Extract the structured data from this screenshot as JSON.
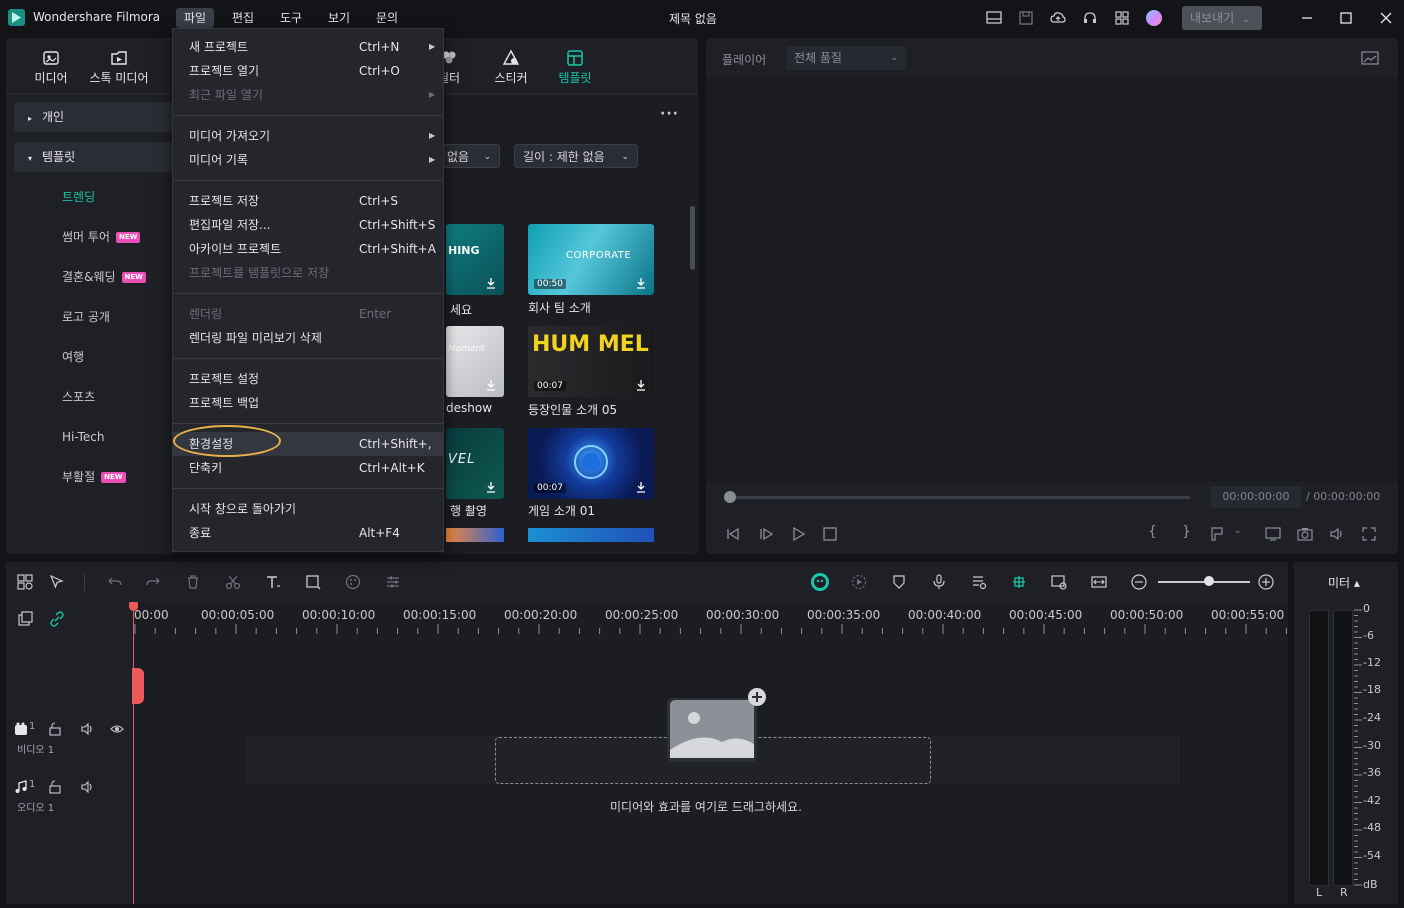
{
  "app": {
    "name": "Wondershare Filmora",
    "document_title": "제목 없음",
    "export_label": "내보내기"
  },
  "menubar": {
    "items": [
      "파일",
      "편집",
      "도구",
      "보기",
      "문의"
    ]
  },
  "library": {
    "tabs": [
      "미디어",
      "스톡 미디어",
      "필터",
      "스티커",
      "템플릿"
    ],
    "more_label": "···",
    "sidebar": {
      "groups": [
        {
          "label": "개인",
          "expanded": false
        },
        {
          "label": "템플릿",
          "expanded": true
        }
      ],
      "items": [
        {
          "label": "트렌딩",
          "new": false,
          "active": true
        },
        {
          "label": "썸머 투어",
          "new": true,
          "active": false
        },
        {
          "label": "결혼&웨딩",
          "new": true,
          "active": false
        },
        {
          "label": "로고 공개",
          "new": false,
          "active": false
        },
        {
          "label": "여행",
          "new": false,
          "active": false
        },
        {
          "label": "스포츠",
          "new": false,
          "active": false
        },
        {
          "label": "Hi-Tech",
          "new": false,
          "active": false
        },
        {
          "label": "부활절",
          "new": true,
          "active": false
        }
      ],
      "new_badge": "NEW"
    },
    "filters": [
      {
        "label": "없음"
      },
      {
        "label": "길이 : 제한 없음"
      }
    ],
    "templates": [
      {
        "label": "세요",
        "duration": "",
        "thumb_text": "HING"
      },
      {
        "label": "회사 팀 소개",
        "duration": "00:50",
        "thumb_text": "CORPORATE"
      },
      {
        "label": "deshow",
        "duration": "",
        "thumb_text": "Moment"
      },
      {
        "label": "등장인물 소개 05",
        "duration": "00:07",
        "thumb_text": "HUM MEL"
      },
      {
        "label": "행 촬영",
        "duration": "",
        "thumb_text": "VEL"
      },
      {
        "label": "게임 소개 01",
        "duration": "00:07",
        "thumb_text": ""
      }
    ]
  },
  "file_menu": {
    "items": [
      {
        "label": "새 프로젝트",
        "shortcut": "Ctrl+N",
        "submenu": true,
        "disabled": false
      },
      {
        "label": "프로젝트 열기",
        "shortcut": "Ctrl+O",
        "submenu": false,
        "disabled": false
      },
      {
        "label": "최근 파일 열기",
        "shortcut": "",
        "submenu": true,
        "disabled": true
      },
      {
        "label": "미디어 가져오기",
        "shortcut": "",
        "submenu": true,
        "disabled": false
      },
      {
        "label": "미디어 기록",
        "shortcut": "",
        "submenu": true,
        "disabled": false
      },
      {
        "label": "프로젝트 저장",
        "shortcut": "Ctrl+S",
        "submenu": false,
        "disabled": false
      },
      {
        "label": "편집파일 저장...",
        "shortcut": "Ctrl+Shift+S",
        "submenu": false,
        "disabled": false
      },
      {
        "label": "아카이브 프로젝트",
        "shortcut": "Ctrl+Shift+A",
        "submenu": false,
        "disabled": false
      },
      {
        "label": "프로젝트를 템플릿으로 저장",
        "shortcut": "",
        "submenu": false,
        "disabled": true
      },
      {
        "label": "렌더링",
        "shortcut": "Enter",
        "submenu": false,
        "disabled": true
      },
      {
        "label": "렌더링 파일 미리보기 삭제",
        "shortcut": "",
        "submenu": false,
        "disabled": false
      },
      {
        "label": "프로젝트 설정",
        "shortcut": "",
        "submenu": false,
        "disabled": false
      },
      {
        "label": "프로젝트 백업",
        "shortcut": "",
        "submenu": false,
        "disabled": false
      },
      {
        "label": "환경설정",
        "shortcut": "Ctrl+Shift+,",
        "submenu": false,
        "disabled": false,
        "highlighted": true
      },
      {
        "label": "단축키",
        "shortcut": "Ctrl+Alt+K",
        "submenu": false,
        "disabled": false
      },
      {
        "label": "시작 창으로 돌아가기",
        "shortcut": "",
        "submenu": false,
        "disabled": false
      },
      {
        "label": "종료",
        "shortcut": "Alt+F4",
        "submenu": false,
        "disabled": false
      }
    ]
  },
  "player": {
    "label": "플레이어",
    "quality": "전체 품질",
    "current_time": "00:00:00:00",
    "total_time": "/ 00:00:00:00",
    "progress": 0
  },
  "timeline": {
    "ruler": [
      "00:00",
      "00:00:05:00",
      "00:00:10:00",
      "00:00:15:00",
      "00:00:20:00",
      "00:00:25:00",
      "00:00:30:00",
      "00:00:35:00",
      "00:00:40:00",
      "00:00:45:00",
      "00:00:50:00",
      "00:00:55:00"
    ],
    "tracks": [
      {
        "name": "비디오 1",
        "index": "1"
      },
      {
        "name": "오디오 1",
        "index": "1"
      }
    ],
    "drop_hint": "미디어와 효과를 여기로 드래그하세요.",
    "zoom": 0.55
  },
  "meter": {
    "title": "미터 ▴",
    "scale": [
      "0",
      "-6",
      "-12",
      "-18",
      "-24",
      "-30",
      "-36",
      "-42",
      "-48",
      "-54",
      "dB"
    ],
    "left_label": "L",
    "right_label": "R"
  },
  "colors": {
    "accent": "#19c6a7",
    "playhead": "#ec5a5a",
    "highlight": "#e7b14a",
    "new_badge": "#e94fb7"
  }
}
